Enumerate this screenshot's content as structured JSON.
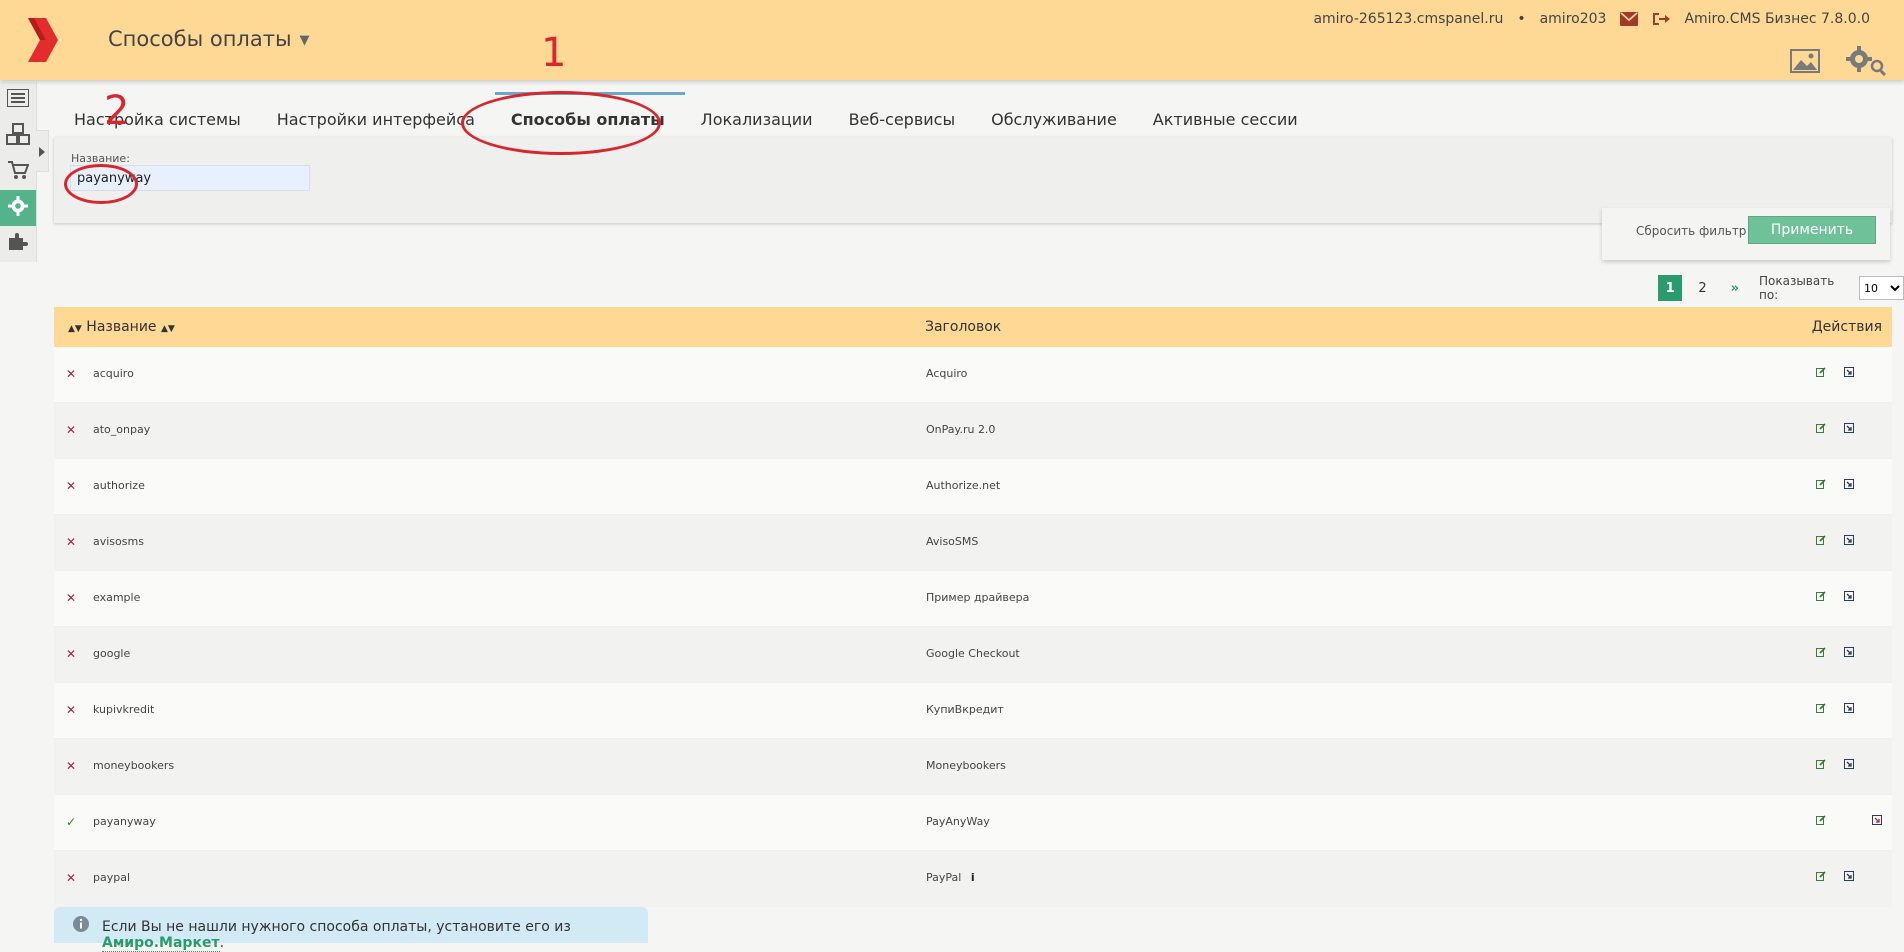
{
  "header": {
    "module_title": "Способы оплаты",
    "host": "amiro-265123.cmspanel.ru",
    "separator": "•",
    "user": "amiro203",
    "version": "Amiro.CMS Бизнес 7.8.0.0",
    "colors": {
      "bar": "#fed996",
      "accent": "#2a9b6c",
      "logo": "#e32c2c"
    }
  },
  "tabs": [
    {
      "label": "Настройка системы"
    },
    {
      "label": "Настройки интерфейса"
    },
    {
      "label": "Способы оплаты",
      "active": true
    },
    {
      "label": "Локализации"
    },
    {
      "label": "Веб-сервисы"
    },
    {
      "label": "Обслуживание"
    },
    {
      "label": "Активные сессии"
    }
  ],
  "filter": {
    "label": "Название:",
    "value": "payanyway",
    "reset_label": "Сбросить фильтр",
    "apply_label": "Применить"
  },
  "pager": {
    "pages": [
      "1",
      "2"
    ],
    "current": "1",
    "next": "»",
    "per_page_label": "Показывать по:",
    "per_page_value": "10"
  },
  "table": {
    "columns": {
      "name": "Название",
      "title": "Заголовок",
      "actions": "Действия"
    },
    "rows": [
      {
        "status": "off",
        "name": "acquiro",
        "title": "Acquiro"
      },
      {
        "status": "off",
        "name": "ato_onpay",
        "title": "OnPay.ru 2.0"
      },
      {
        "status": "off",
        "name": "authorize",
        "title": "Authorize.net"
      },
      {
        "status": "off",
        "name": "avisosms",
        "title": "AvisoSMS"
      },
      {
        "status": "off",
        "name": "example",
        "title": "Пример драйвера"
      },
      {
        "status": "off",
        "name": "google",
        "title": "Google Checkout"
      },
      {
        "status": "off",
        "name": "kupivkredit",
        "title": "КупиВкредит"
      },
      {
        "status": "off",
        "name": "moneybookers",
        "title": "Moneybookers"
      },
      {
        "status": "on",
        "name": "payanyway",
        "title": "PayAnyWay"
      },
      {
        "status": "off",
        "name": "paypal",
        "title": "PayPal",
        "info": "i"
      }
    ]
  },
  "notice": {
    "text": "Если Вы не нашли нужного способа оплаты, установите его из ",
    "link": "Амиро.Маркет",
    "suffix": "."
  },
  "annotations": {
    "one": "1",
    "two": "2"
  }
}
